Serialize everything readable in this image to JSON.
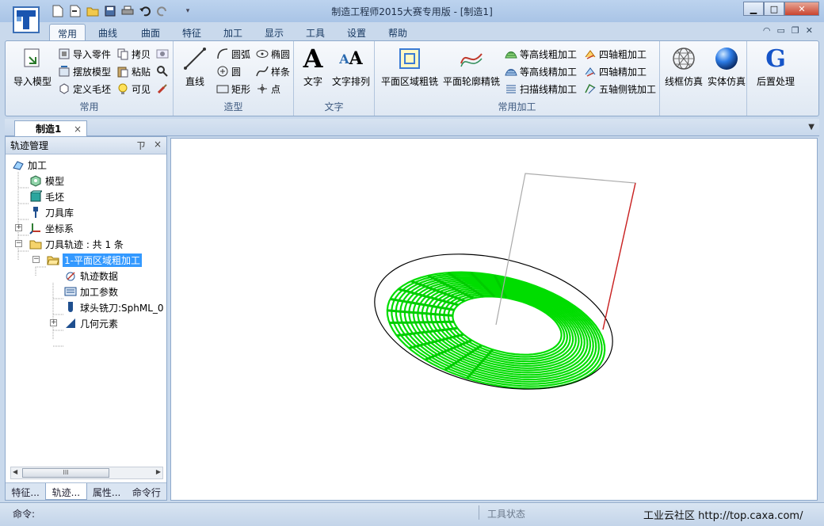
{
  "window": {
    "title": "制造工程师2015大赛专用版 - [制造1]",
    "accent": "#3399ff"
  },
  "ribbon_tabs": [
    "常用",
    "曲线",
    "曲面",
    "特征",
    "加工",
    "显示",
    "工具",
    "设置",
    "帮助"
  ],
  "ribbon": {
    "group_common": {
      "label": "常用",
      "import_model": "导入模型",
      "import_part": "导入零件",
      "place_model": "摆放模型",
      "define_stock": "定义毛坯",
      "copy": "拷贝",
      "paste": "粘贴",
      "visible": "可见"
    },
    "group_modeling": {
      "label": "造型",
      "line": "直线",
      "arc": "圆弧",
      "circle": "圆",
      "rectangle": "矩形",
      "ellipse": "椭圆",
      "spline": "样条",
      "point": "点"
    },
    "group_text": {
      "label": "文字",
      "text": "文字",
      "text_arrange": "文字排列"
    },
    "group_machining": {
      "label": "常用加工",
      "plane_area_rough": "平面区域粗铣",
      "plane_contour_finish": "平面轮廓精铣",
      "contour_rough": "等高线粗加工",
      "contour_finish": "等高线精加工",
      "scan_finish": "扫描线精加工",
      "four_axis_rough": "四轴粗加工",
      "four_axis_finish": "四轴精加工",
      "five_axis_side": "五轴侧铣加工"
    },
    "group_sim": {
      "wireframe_sim": "线框仿真",
      "solid_sim": "实体仿真",
      "post_process": "后置处理"
    }
  },
  "doc_tab": {
    "label": "制造1",
    "close": "×"
  },
  "panel": {
    "title": "轨迹管理",
    "pin": "ㄗ",
    "close": "×",
    "tree": {
      "root": "加工",
      "model": "模型",
      "stock": "毛坯",
      "tool_library": "刀具库",
      "coordinate": "坐标系",
      "toolpath": "刀具轨迹 : 共 1 条",
      "op1": "1-平面区域粗加工",
      "path_data": "轨迹数据",
      "params": "加工参数",
      "tool": "球头铣刀:SphML_0",
      "geometry": "几何元素"
    },
    "scroll_thumb": "III",
    "tabs": [
      "特征...",
      "轨迹...",
      "属性...",
      "命令行"
    ]
  },
  "status": {
    "command": "命令:",
    "tool_status": "工具状态",
    "watermark": "工业云社区 http://top.caxa.com/"
  }
}
